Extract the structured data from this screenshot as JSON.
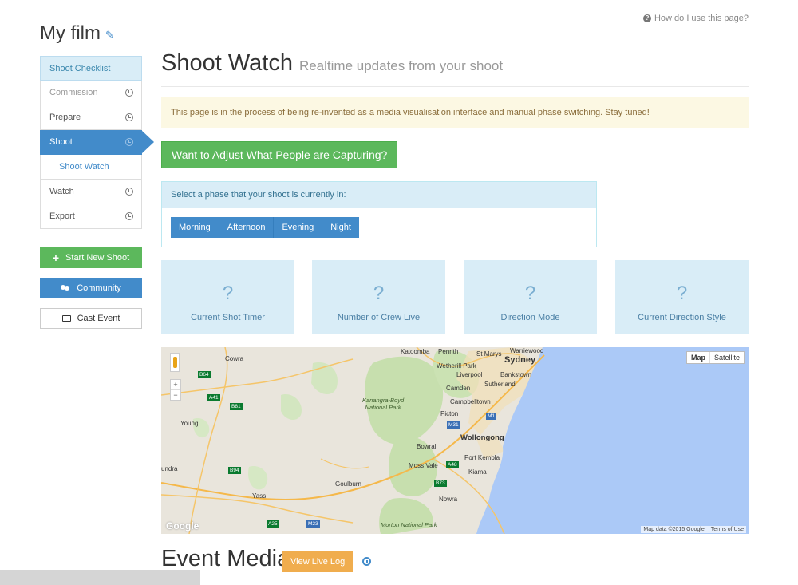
{
  "help": {
    "label": "How do I use this page?"
  },
  "film": {
    "title": "My film"
  },
  "sidebar": {
    "items": [
      {
        "label": "Shoot Checklist",
        "state": "header"
      },
      {
        "label": "Commission",
        "state": "muted",
        "icon": "clock-icon"
      },
      {
        "label": "Prepare",
        "state": "normal",
        "icon": "clock-icon"
      },
      {
        "label": "Shoot",
        "state": "active",
        "icon": "clock-icon"
      },
      {
        "label": "Shoot Watch",
        "state": "sub"
      },
      {
        "label": "Watch",
        "state": "normal",
        "icon": "clock-icon"
      },
      {
        "label": "Export",
        "state": "normal",
        "icon": "clock-icon"
      }
    ],
    "start_new_shoot": "Start New Shoot",
    "community": "Community",
    "cast_event": "Cast Event"
  },
  "main": {
    "title": "Shoot Watch",
    "subtitle": "Realtime updates from your shoot",
    "notice": "This page is in the process of being re-invented as a media visualisation interface and manual phase switching. Stay tuned!",
    "adjust_button": "Want to Adjust What People are Capturing?",
    "phase": {
      "prompt": "Select a phase that your shoot is currently in:",
      "options": [
        "Morning",
        "Afternoon",
        "Evening",
        "Night"
      ]
    },
    "stats": [
      {
        "value": "?",
        "label": "Current Shot Timer"
      },
      {
        "value": "?",
        "label": "Number of Crew Live"
      },
      {
        "value": "?",
        "label": "Direction Mode"
      },
      {
        "value": "?",
        "label": "Current Direction Style"
      }
    ]
  },
  "map": {
    "type_buttons": [
      "Map",
      "Satellite"
    ],
    "zoom_in": "+",
    "zoom_out": "−",
    "logo": "Google",
    "attribution": "Map data ©2015 Google",
    "terms": "Terms of Use",
    "places": {
      "katoomba": "Katoomba",
      "penrith": "Penrith",
      "st_marys": "St Marys",
      "warriewood": "Warriewood",
      "sydney": "Sydney",
      "wetherill_park": "Wetherill Park",
      "liverpool": "Liverpool",
      "bankstown": "Bankstown",
      "cowra": "Cowra",
      "camden": "Camden",
      "sutherland": "Sutherland",
      "kanangra_boyd": "Kanangra-Boyd\nNational Park",
      "campbelltown": "Campbelltown",
      "young": "Young",
      "picton": "Picton",
      "wollongong": "Wollongong",
      "bowral": "Bowral",
      "port_kembla": "Port Kembla",
      "undra": "undra",
      "moss_vale": "Moss Vale",
      "kiama": "Kiama",
      "goulburn": "Goulburn",
      "yass": "Yass",
      "nowra": "Nowra",
      "morton": "Morton National Park"
    },
    "routes": [
      "B64",
      "A41",
      "B81",
      "M31",
      "B94",
      "M1",
      "A48",
      "B73",
      "A25",
      "M23"
    ]
  },
  "event_media": {
    "title": "Event Media",
    "live_log": "View Live Log"
  }
}
